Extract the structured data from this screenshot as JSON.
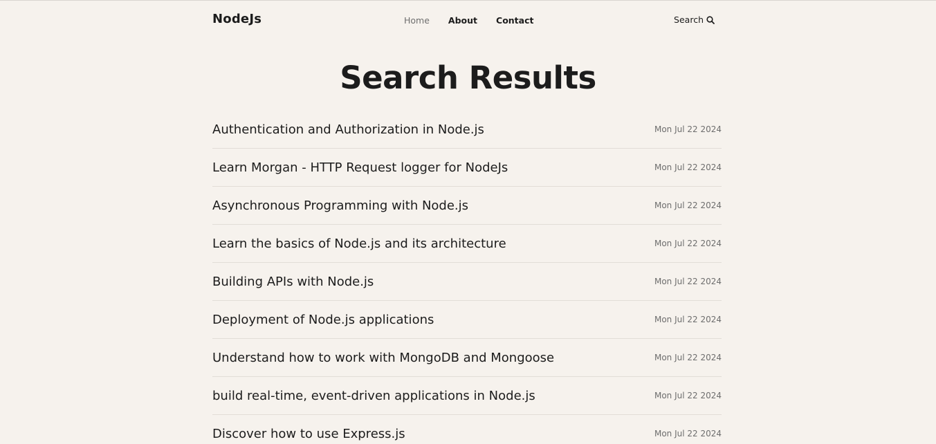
{
  "header": {
    "logo": "NodeJs",
    "nav": [
      {
        "label": "Home",
        "active": true
      },
      {
        "label": "About",
        "active": false
      },
      {
        "label": "Contact",
        "active": false
      }
    ],
    "search_label": "Search",
    "search_icon": "search-icon"
  },
  "page_title": "Search Results",
  "results": [
    {
      "title": "Authentication and Authorization in Node.js",
      "date": "Mon Jul 22 2024"
    },
    {
      "title": "Learn Morgan - HTTP Request logger for NodeJs",
      "date": "Mon Jul 22 2024"
    },
    {
      "title": "Asynchronous Programming with Node.js",
      "date": "Mon Jul 22 2024"
    },
    {
      "title": "Learn the basics of Node.js and its architecture",
      "date": "Mon Jul 22 2024"
    },
    {
      "title": "Building APIs with Node.js",
      "date": "Mon Jul 22 2024"
    },
    {
      "title": "Deployment of Node.js applications",
      "date": "Mon Jul 22 2024"
    },
    {
      "title": "Understand how to work with MongoDB and Mongoose",
      "date": "Mon Jul 22 2024"
    },
    {
      "title": "build real-time, event-driven applications in Node.js",
      "date": "Mon Jul 22 2024"
    },
    {
      "title": "Discover how to use Express.js",
      "date": "Mon Jul 22 2024"
    }
  ],
  "colors": {
    "background": "#f6f2ed",
    "text": "#1c1c1c",
    "muted": "#6d6d6d",
    "divider": "#e2ddd7"
  }
}
